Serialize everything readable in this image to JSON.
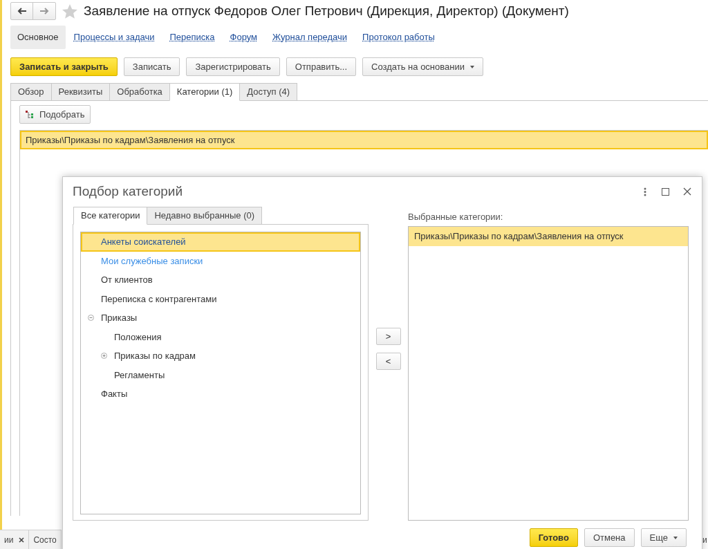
{
  "document": {
    "title": "Заявление на отпуск Федоров Олег Петрович (Дирекция, Директор) (Документ)",
    "favorite": false,
    "nav": [
      {
        "label": "Основное",
        "selected": true
      },
      {
        "label": "Процессы и задачи",
        "selected": false
      },
      {
        "label": "Переписка",
        "selected": false
      },
      {
        "label": "Форум",
        "selected": false
      },
      {
        "label": "Журнал передачи",
        "selected": false
      },
      {
        "label": "Протокол работы",
        "selected": false
      }
    ],
    "buttons": [
      {
        "label": "Записать и закрыть",
        "kind": "primary"
      },
      {
        "label": "Записать",
        "kind": "plain"
      },
      {
        "label": "Зарегистрировать",
        "kind": "plain"
      },
      {
        "label": "Отправить...",
        "kind": "plain"
      },
      {
        "label": "Создать на основании",
        "kind": "menu"
      }
    ],
    "tabs": [
      {
        "label": "Обзор",
        "selected": false
      },
      {
        "label": "Реквизиты",
        "selected": false
      },
      {
        "label": "Обработка",
        "selected": false
      },
      {
        "label": "Категории (1)",
        "selected": true
      },
      {
        "label": "Доступ (4)",
        "selected": false
      }
    ],
    "pick_button": "Подобрать",
    "categories": [
      {
        "path": "Приказы\\Приказы по кадрам\\Заявления на отпуск",
        "selected": true
      }
    ]
  },
  "taskbar": [
    {
      "label": "ии",
      "closable": true
    },
    {
      "label": "Состо",
      "closable": false
    }
  ],
  "edge_text": "и",
  "dialog": {
    "title": "Подбор категорий",
    "tabs": [
      {
        "label": "Все категории",
        "selected": true
      },
      {
        "label": "Недавно выбранные (0)",
        "selected": false
      }
    ],
    "tree": [
      {
        "label": "Анкеты соискателей",
        "selected": true,
        "color": "#1f4e9a"
      },
      {
        "label": "Мои служебные записки",
        "selected": false,
        "color": "#3a8ee6"
      },
      {
        "label": "От клиентов",
        "selected": false,
        "color": "#333333"
      },
      {
        "label": "Переписка с контрагентами",
        "selected": false,
        "color": "#333333"
      },
      {
        "label": "Приказы",
        "selected": false,
        "color": "#333333",
        "expanded": true,
        "children": [
          {
            "label": "Положения",
            "selected": false,
            "color": "#333333"
          },
          {
            "label": "Приказы по кадрам",
            "selected": false,
            "color": "#333333",
            "expanded": false
          },
          {
            "label": "Регламенты",
            "selected": false,
            "color": "#333333"
          }
        ]
      },
      {
        "label": "Факты",
        "selected": false,
        "color": "#333333"
      }
    ],
    "add_button": ">",
    "remove_button": "<",
    "selected_label": "Выбранные категории:",
    "selected_items": [
      {
        "path": "Приказы\\Приказы по кадрам\\Заявления на отпуск",
        "selected": true
      }
    ],
    "footer": [
      {
        "label": "Готово",
        "kind": "primary"
      },
      {
        "label": "Отмена",
        "kind": "plain"
      },
      {
        "label": "Еще",
        "kind": "menu"
      }
    ]
  }
}
